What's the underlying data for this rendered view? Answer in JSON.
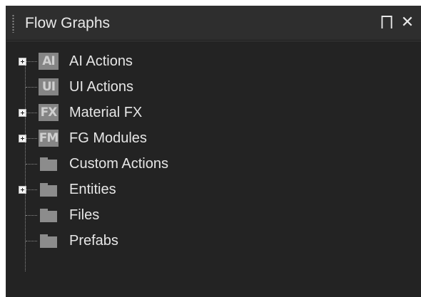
{
  "panel": {
    "title": "Flow Graphs",
    "pin_glyph": "⨅",
    "close_glyph": "✕"
  },
  "tree": {
    "items": [
      {
        "label": "AI Actions",
        "icon_text": "AI",
        "icon": "ai-icon",
        "expandable": true
      },
      {
        "label": "UI Actions",
        "icon_text": "UI",
        "icon": "ui-icon",
        "expandable": false
      },
      {
        "label": "Material FX",
        "icon_text": "FX",
        "icon": "fx-icon",
        "expandable": true
      },
      {
        "label": "FG Modules",
        "icon_text": "FM",
        "icon": "fm-icon",
        "expandable": true
      },
      {
        "label": "Custom Actions",
        "icon_text": "",
        "icon": "folder-icon",
        "expandable": false
      },
      {
        "label": "Entities",
        "icon_text": "",
        "icon": "folder-icon",
        "expandable": true
      },
      {
        "label": "Files",
        "icon_text": "",
        "icon": "folder-icon",
        "expandable": false
      },
      {
        "label": "Prefabs",
        "icon_text": "",
        "icon": "folder-icon",
        "expandable": false
      }
    ]
  },
  "colors": {
    "panel_bg": "#232323",
    "titlebar_bg": "#2e2e2e",
    "text": "#e6e6e6",
    "icon_gray": "#858585"
  }
}
